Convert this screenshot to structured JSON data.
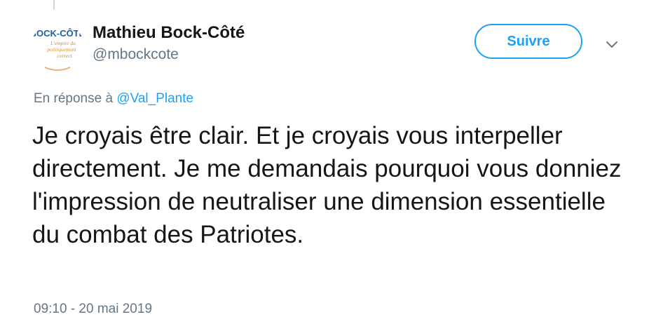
{
  "tweet": {
    "author": {
      "name": "Mathieu Bock-Côté",
      "handle": "@mbockcote",
      "avatar": {
        "title": "BOCK-CÔTÉ",
        "subtitle_lines": [
          "L'empire du",
          "politiquement",
          "correct"
        ]
      }
    },
    "follow_label": "Suivre",
    "more_icon": "chevron-down-icon",
    "reply_prefix": "En réponse à",
    "reply_mention": "@Val_Plante",
    "text": "Je croyais être clair. Et je croyais vous interpeller directement. Je me demandais pourquoi vous donniez l'impression de neutraliser une dimension essentielle du combat des Patriotes.",
    "timestamp": "09:10 - 20 mai 2019"
  },
  "colors": {
    "accent": "#1da1f2",
    "text": "#14171a",
    "secondary": "#657786",
    "avatar_brand": "#1f5fa3"
  }
}
